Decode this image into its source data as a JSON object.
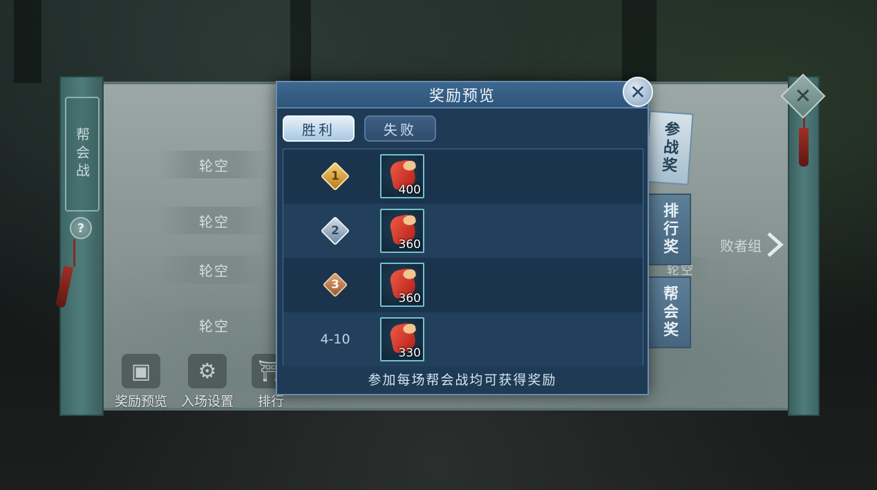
{
  "colors": {
    "modal_bg": "#1e3a55",
    "modal_header": "#3d6790",
    "item_border": "#73c3cf",
    "scroll_bg": "#8b9896"
  },
  "scroll": {
    "title": "帮会战",
    "help_icon": "?",
    "bye_slots_left": [
      "轮空",
      "轮空",
      "轮空",
      "轮空"
    ],
    "bye_slot_right": "轮空",
    "loser_bracket_label": "败者组",
    "bottom_buttons": [
      {
        "label": "奖励预览",
        "icon": "treasure-chest-icon"
      },
      {
        "label": "入场设置",
        "icon": "gear-icon"
      },
      {
        "label": "排行",
        "icon": "torii-gate-icon"
      }
    ],
    "close_icon": "✕"
  },
  "side_tabs": [
    "参战奖",
    "排行奖",
    "帮会奖"
  ],
  "modal": {
    "title": "奖励预览",
    "close_icon": "✕",
    "tabs": [
      {
        "label": "胜利",
        "active": true
      },
      {
        "label": "失败",
        "active": false
      }
    ],
    "rows": [
      {
        "rank": "1",
        "medal": "gold",
        "item": "red-pouch-icon",
        "qty": "400"
      },
      {
        "rank": "2",
        "medal": "silver",
        "item": "red-pouch-icon",
        "qty": "360"
      },
      {
        "rank": "3",
        "medal": "bronze",
        "item": "red-pouch-icon",
        "qty": "360"
      },
      {
        "rank": "4-10",
        "medal": "none",
        "item": "red-pouch-icon",
        "qty": "330"
      }
    ],
    "footer": "参加每场帮会战均可获得奖励"
  }
}
